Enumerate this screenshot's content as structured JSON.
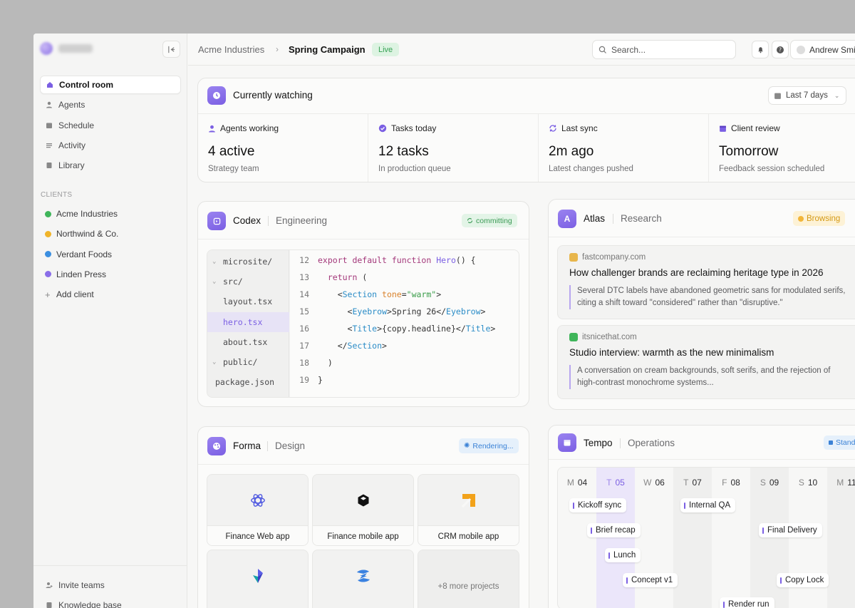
{
  "sidebar": {
    "nav": [
      {
        "label": "Control room",
        "icon": "home-icon",
        "active": true
      },
      {
        "label": "Agents",
        "icon": "user-icon"
      },
      {
        "label": "Schedule",
        "icon": "calendar-icon"
      },
      {
        "label": "Activity",
        "icon": "list-icon"
      },
      {
        "label": "Library",
        "icon": "book-icon"
      }
    ],
    "clients_label": "CLIENTS",
    "clients": [
      {
        "label": "Acme Industries",
        "color": "#3fb55a"
      },
      {
        "label": "Northwind & Co.",
        "color": "#f0b429"
      },
      {
        "label": "Verdant Foods",
        "color": "#3b8fe0"
      },
      {
        "label": "Linden Press",
        "color": "#8a6ee8"
      }
    ],
    "add_client": "Add client",
    "bottom": [
      {
        "label": "Invite teams",
        "icon": "invite-icon"
      },
      {
        "label": "Knowledge base",
        "icon": "book-icon"
      }
    ]
  },
  "topbar": {
    "crumb_parent": "Acme Industries",
    "crumb_current": "Spring Campaign",
    "status": "Live",
    "search_placeholder": "Search...",
    "user_name": "Andrew Smith"
  },
  "watching": {
    "title": "Currently watching",
    "range": "Last 7 days",
    "stats": [
      {
        "label": "Agents working",
        "value": "4 active",
        "sub": "Strategy team"
      },
      {
        "label": "Tasks today",
        "value": "12 tasks",
        "sub": "In production queue"
      },
      {
        "label": "Last sync",
        "value": "2m ago",
        "sub": "Latest changes pushed"
      },
      {
        "label": "Client review",
        "value": "Tomorrow",
        "sub": "Feedback session scheduled"
      }
    ]
  },
  "codex": {
    "name": "Codex",
    "team": "Engineering",
    "status": "committing",
    "files": [
      "microsite/",
      "src/",
      "layout.tsx",
      "hero.tsx",
      "about.tsx",
      "public/",
      "package.json"
    ],
    "line_numbers": [
      "12",
      "13",
      "14",
      "15",
      "16",
      "17",
      "18",
      "19"
    ],
    "code": {
      "l12_kw": "export default function",
      "l12_fn": "Hero",
      "l12_rest": "() {",
      "l13_kw": "return",
      "l13_rest": " (",
      "l14_tag": "Section",
      "l14_attr": "tone",
      "l14_str": "\"warm\"",
      "l15_tag": "Eyebrow",
      "l15_text": "Spring 26",
      "l16_tag": "Title",
      "l16_text": "{copy.headline}",
      "l17_tag": "Section",
      "l18": ")",
      "l19": "}"
    }
  },
  "atlas": {
    "name": "Atlas",
    "team": "Research",
    "status": "Browsing",
    "articles": [
      {
        "source": "fastcompany.com",
        "title": "How challenger brands are reclaiming heritage type in 2026",
        "body": "Several DTC labels have abandoned geometric sans for modulated serifs, citing a shift toward \"considered\" rather than \"disruptive.\"",
        "color": "#e8b64c"
      },
      {
        "source": "itsnicethat.com",
        "title": "Studio interview: warmth as the new minimalism",
        "body": "A conversation on cream backgrounds, soft serifs, and the rejection of high-contrast monochrome systems...",
        "color": "#3fb55a"
      }
    ]
  },
  "forma": {
    "name": "Forma",
    "team": "Design",
    "status": "Rendering...",
    "projects": [
      "Finance Web app",
      "Finance mobile app",
      "CRM mobile app"
    ],
    "more": "+8 more projects"
  },
  "tempo": {
    "name": "Tempo",
    "team": "Operations",
    "status": "Standup",
    "days": [
      {
        "l": "M",
        "d": "04"
      },
      {
        "l": "T",
        "d": "05"
      },
      {
        "l": "W",
        "d": "06"
      },
      {
        "l": "T",
        "d": "07"
      },
      {
        "l": "F",
        "d": "08"
      },
      {
        "l": "S",
        "d": "09"
      },
      {
        "l": "S",
        "d": "10"
      },
      {
        "l": "M",
        "d": "11"
      }
    ],
    "events": [
      "Kickoff sync",
      "Internal QA",
      "Brief recap",
      "Final Delivery",
      "Lunch",
      "Concept v1",
      "Copy Lock",
      "Render run"
    ]
  },
  "colors": {
    "accent": "#7b5fe3",
    "live_bg": "#ddf3e2",
    "live_fg": "#35a153",
    "browsing_bg": "#fdf2d6",
    "browsing_fg": "#d59a15"
  }
}
